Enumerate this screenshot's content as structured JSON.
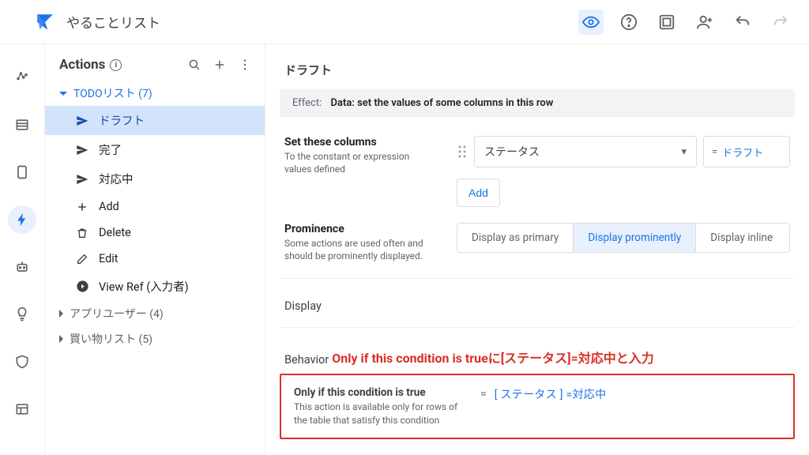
{
  "appbar": {
    "title": "やることリスト"
  },
  "panel": {
    "title": "Actions",
    "groups": [
      {
        "label": "TODOリスト (7)",
        "expanded": true,
        "items": [
          {
            "icon": "send",
            "label": "ドラフト",
            "active": true
          },
          {
            "icon": "send",
            "label": "完了"
          },
          {
            "icon": "send",
            "label": "対応中"
          },
          {
            "icon": "plus",
            "label": "Add"
          },
          {
            "icon": "trash",
            "label": "Delete"
          },
          {
            "icon": "edit",
            "label": "Edit"
          },
          {
            "icon": "arrow-right-circle",
            "label": "View Ref (入力者)"
          }
        ]
      },
      {
        "label": "アプリユーザー (4)",
        "expanded": false
      },
      {
        "label": "買い物リスト (5)",
        "expanded": false
      }
    ]
  },
  "main": {
    "title": "ドラフト",
    "effect_label": "Effect:",
    "effect_value": "Data: set the values of some columns in this row",
    "set_columns": {
      "title": "Set these columns",
      "subtitle": "To the constant or expression values defined",
      "column_name": "ステータス",
      "column_value": "ドラフト",
      "add_label": "Add"
    },
    "prominence": {
      "title": "Prominence",
      "subtitle": "Some actions are used often and should be prominently displayed.",
      "options": [
        "Display as primary",
        "Display prominently",
        "Display inline"
      ],
      "active_index": 1
    },
    "display_section": "Display",
    "behavior_section": "Behavior",
    "annotation": "Only if this condition is trueに[ステータス]=対応中と入力",
    "condition": {
      "title": "Only if this condition is true",
      "subtitle": "This action is available only for rows of the table that satisfy this condition",
      "eq": "=",
      "formula": "[ ステータス ] =対応中"
    }
  }
}
